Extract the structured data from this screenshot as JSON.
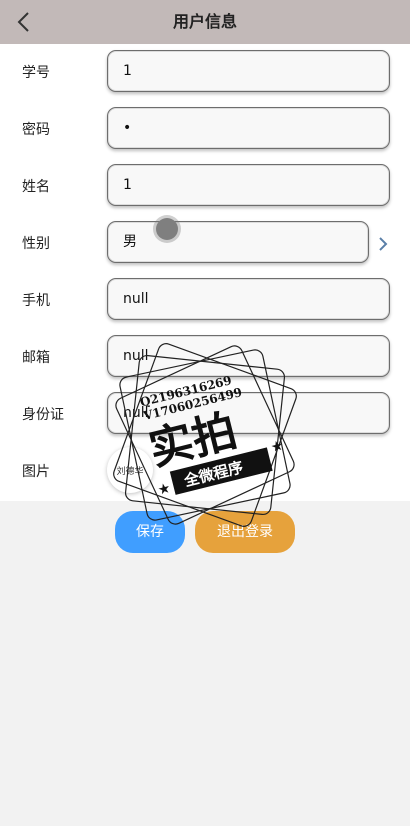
{
  "header": {
    "title": "用户信息"
  },
  "fields": [
    {
      "label": "学号",
      "value": "1"
    },
    {
      "label": "密码",
      "value": "•"
    },
    {
      "label": "姓名",
      "value": "1"
    },
    {
      "label": "性别",
      "value": "男"
    },
    {
      "label": "手机",
      "value": "null"
    },
    {
      "label": "邮箱",
      "value": "null"
    },
    {
      "label": "身份证",
      "value": "null"
    }
  ],
  "image_label": "图片",
  "avatar_text": "刘德华",
  "buttons": {
    "save": "保存",
    "logout": "退出登录"
  },
  "watermark": {
    "line1": "Q2196316269",
    "line2": "V17060256499",
    "big": "实拍",
    "banner": "全微程序"
  },
  "colors": {
    "header_bg": "#c2b9b8",
    "save": "#409eff",
    "logout": "#e6a23c"
  }
}
